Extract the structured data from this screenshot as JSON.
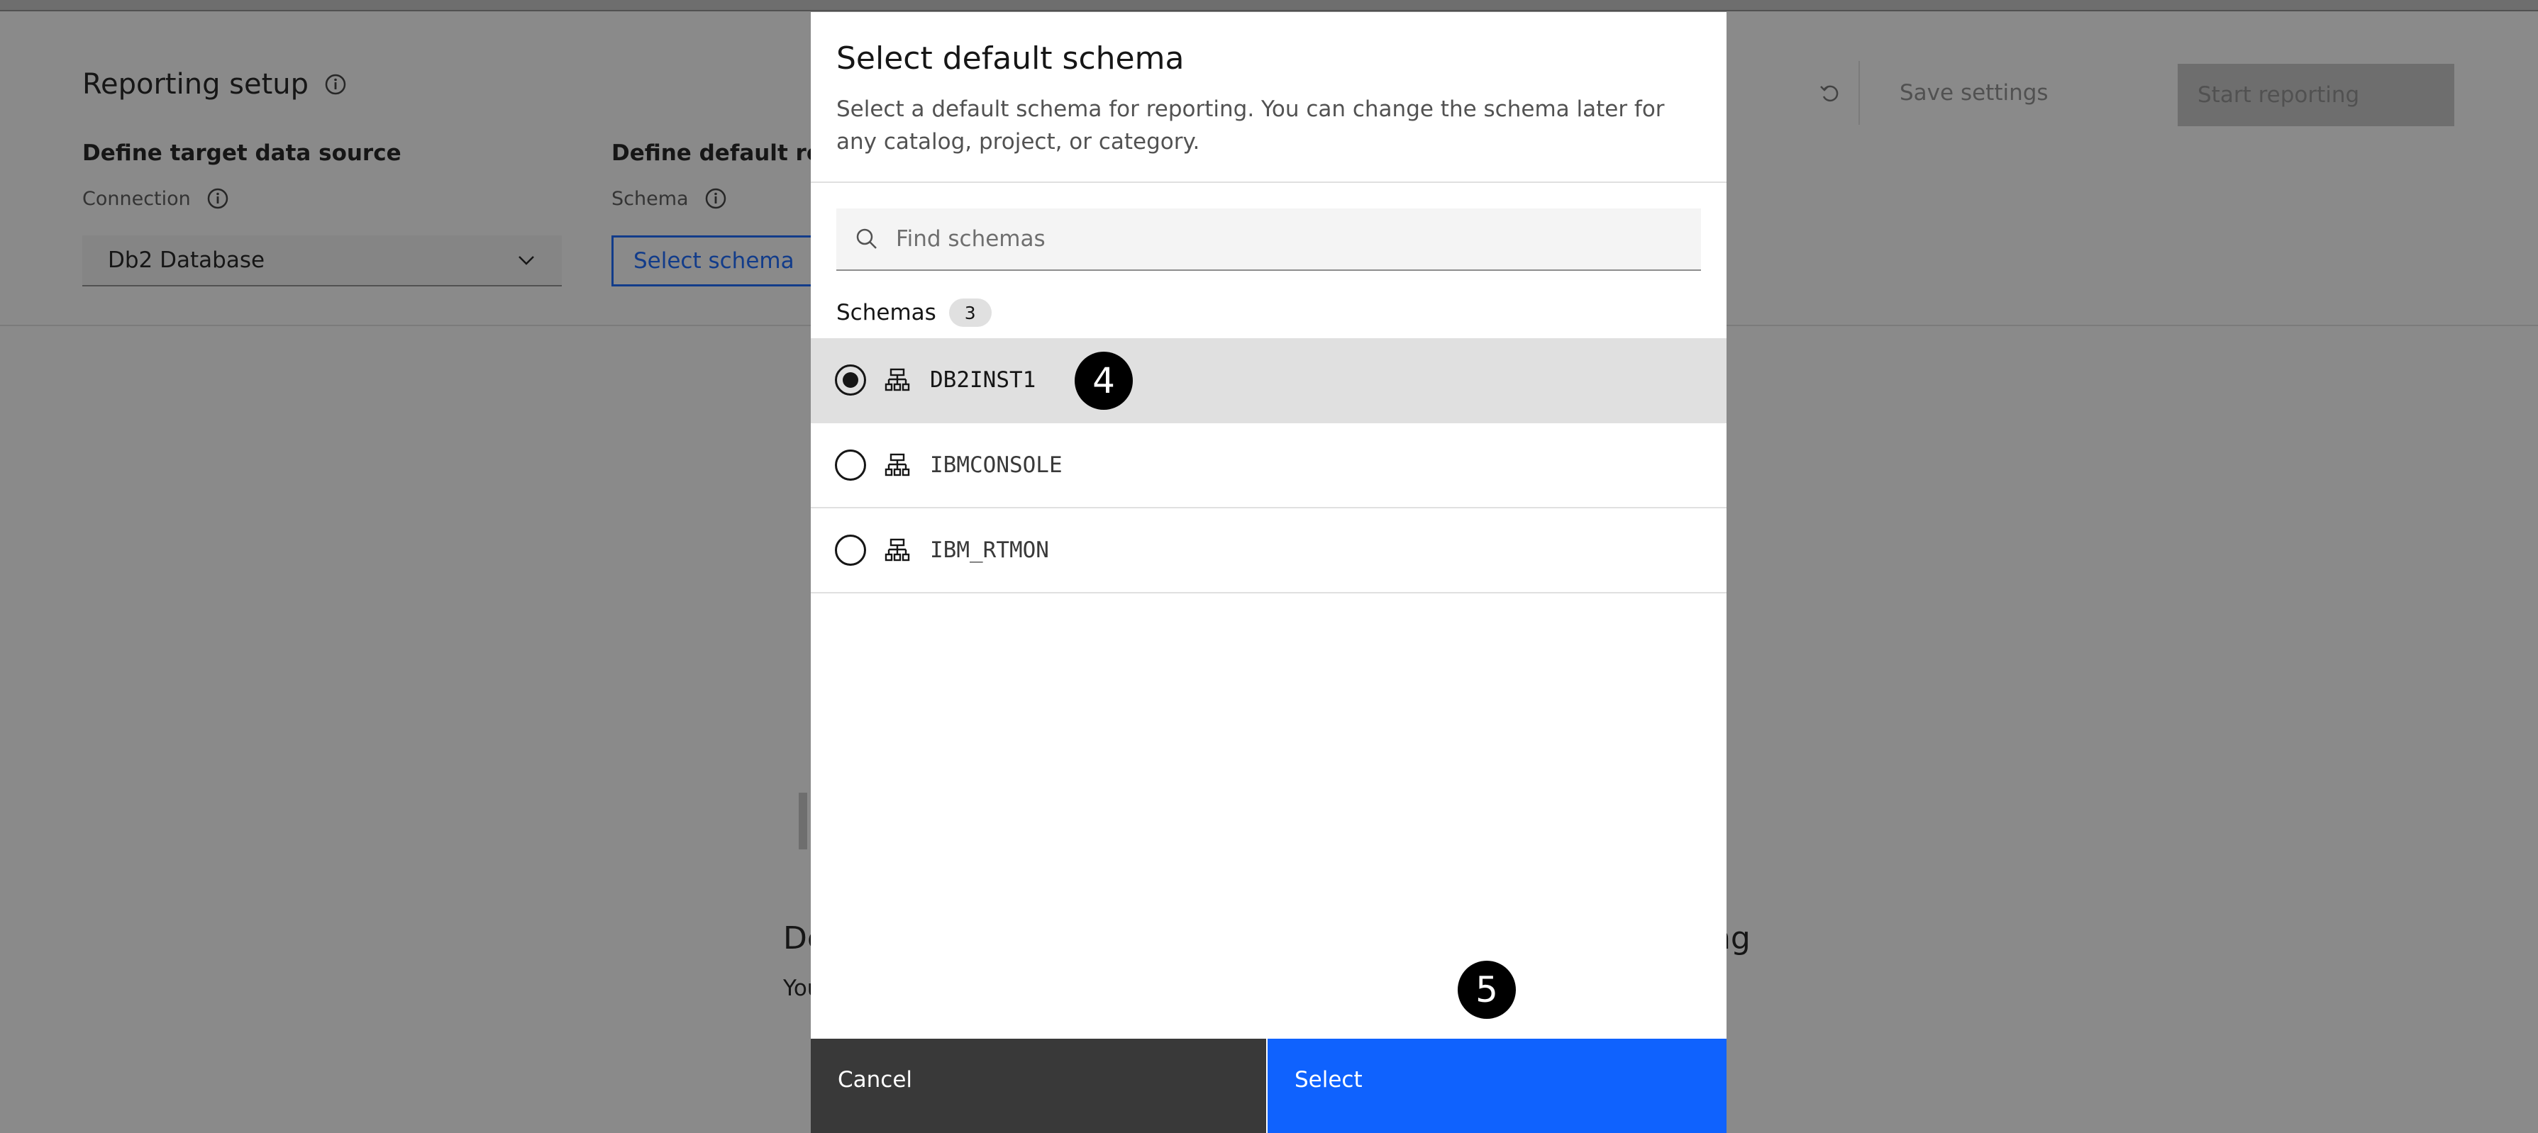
{
  "page": {
    "title": "Reporting setup",
    "save_label": "Save settings",
    "start_label": "Start reporting",
    "target_heading": "Define target data source",
    "connection_label": "Connection",
    "connection_value": "Db2 Database",
    "schema_heading": "Define default repo",
    "schema_label": "Schema",
    "schema_button": "Select schema",
    "empty_heading_left": "De",
    "empty_heading_right": "ng",
    "empty_text": "You"
  },
  "modal": {
    "title": "Select default schema",
    "description": "Select a default schema for reporting. You can change the schema later for any catalog, project, or category.",
    "search_placeholder": "Find schemas",
    "list_label": "Schemas",
    "count": "3",
    "schemas": [
      {
        "name": "DB2INST1",
        "selected": true
      },
      {
        "name": "IBMCONSOLE",
        "selected": false
      },
      {
        "name": "IBM_RTMON",
        "selected": false
      }
    ],
    "cancel_label": "Cancel",
    "select_label": "Select"
  },
  "annotations": {
    "step_4": "4",
    "step_5": "5"
  },
  "colors": {
    "primary": "#0f62fe",
    "secondary": "#393939",
    "selected_row": "#e0e0e0"
  }
}
